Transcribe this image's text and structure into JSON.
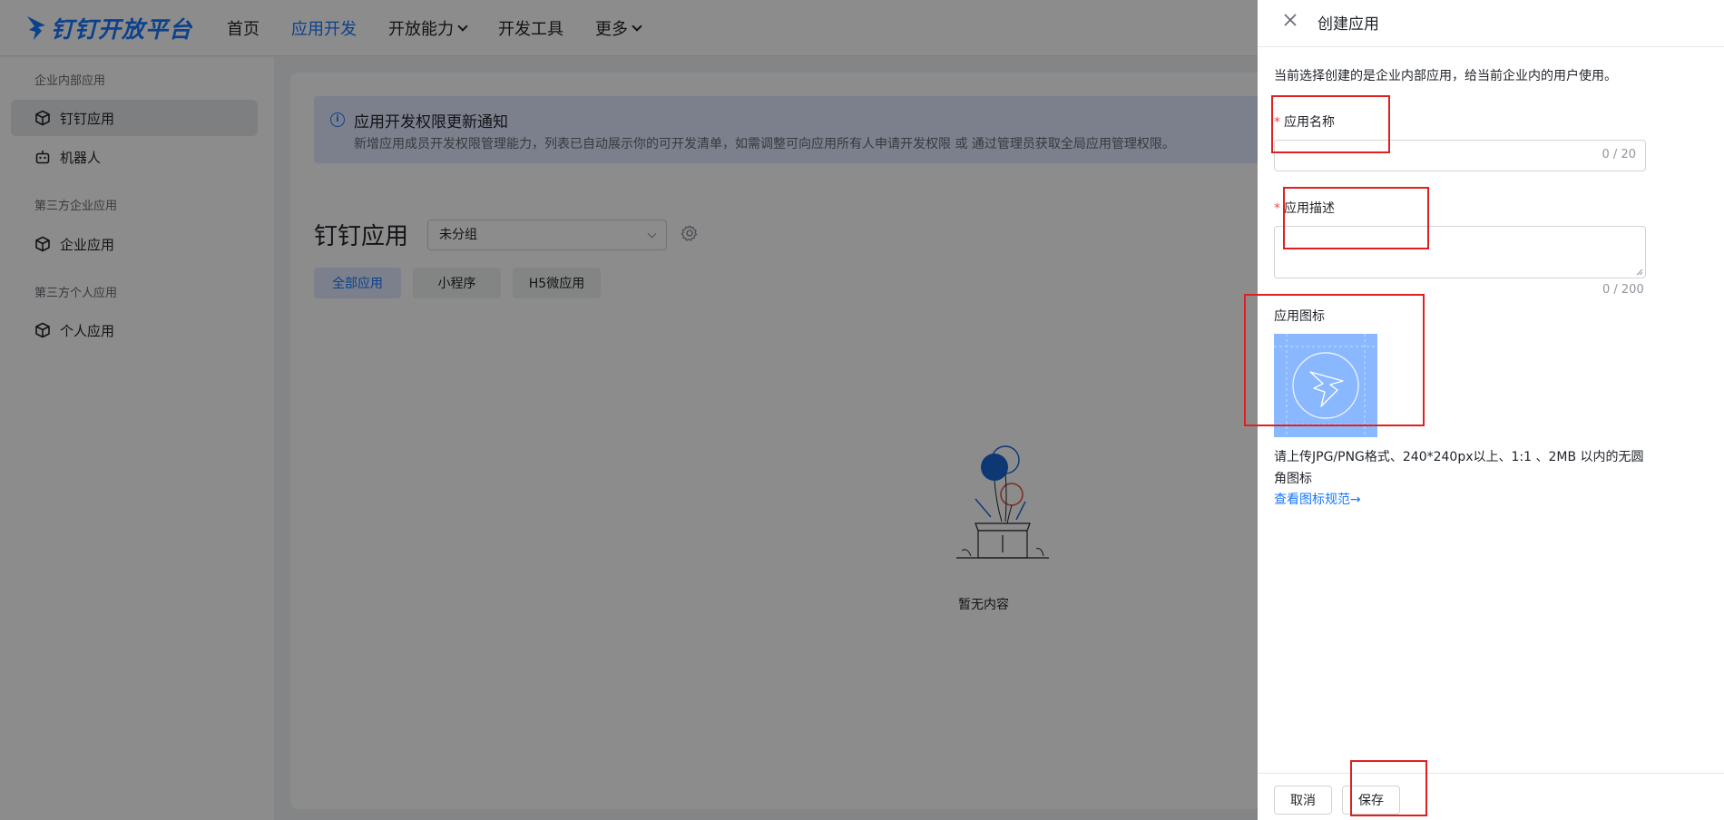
{
  "topnav": {
    "logo_text": "钉钉开放平台",
    "items": [
      {
        "label": "首页"
      },
      {
        "label": "应用开发"
      },
      {
        "label": "开放能力"
      },
      {
        "label": "开发工具"
      },
      {
        "label": "更多"
      }
    ]
  },
  "sidebar": {
    "groups": [
      {
        "title": "企业内部应用",
        "items": [
          {
            "label": "钉钉应用"
          },
          {
            "label": "机器人"
          }
        ]
      },
      {
        "title": "第三方企业应用",
        "items": [
          {
            "label": "企业应用"
          }
        ]
      },
      {
        "title": "第三方个人应用",
        "items": [
          {
            "label": "个人应用"
          }
        ]
      }
    ]
  },
  "notice": {
    "title": "应用开发权限更新通知",
    "desc": "新增应用成员开发权限管理能力，列表已自动展示你的可开发清单，如需调整可向应用所有人申请开发权限 或 通过管理员获取全局应用管理权限。"
  },
  "main": {
    "title": "钉钉应用",
    "group_select": "未分组",
    "tabs": [
      {
        "label": "全部应用"
      },
      {
        "label": "小程序"
      },
      {
        "label": "H5微应用"
      }
    ],
    "empty_text": "暂无内容"
  },
  "drawer": {
    "title": "创建应用",
    "intro": "当前选择创建的是企业内部应用，给当前企业内的用户使用。",
    "name_label": "应用名称",
    "name_count": "0 / 20",
    "desc_label": "应用描述",
    "desc_count": "0 / 200",
    "icon_label": "应用图标",
    "icon_tip": "请上传JPG/PNG格式、240*240px以上、1:1 、2MB 以内的无圆角图标",
    "icon_link": "查看图标规范→",
    "cancel": "取消",
    "save": "保存"
  },
  "colors": {
    "accent": "#1677ff",
    "annotation": "#e02020",
    "required": "#f54a45"
  }
}
